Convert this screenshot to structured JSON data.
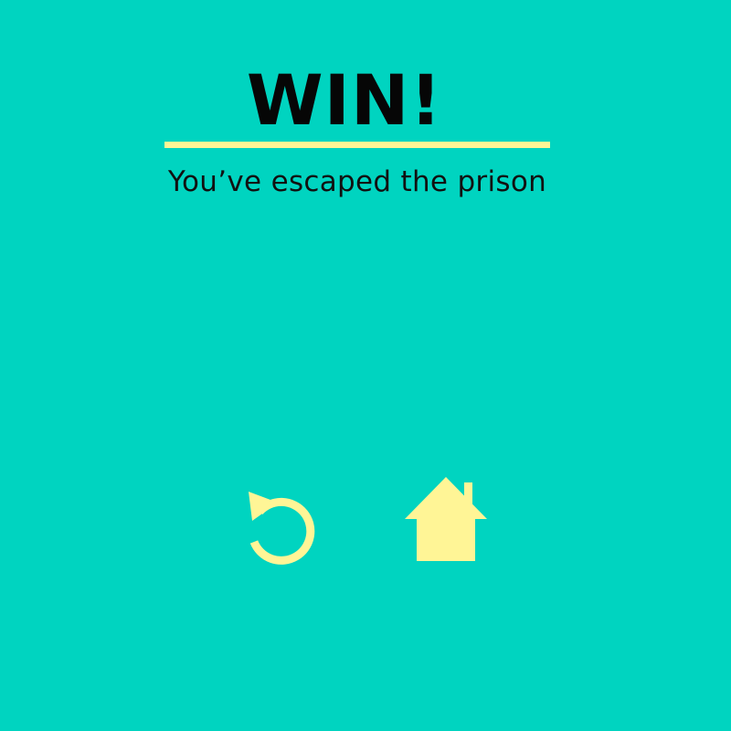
{
  "screen": {
    "title": "WIN!",
    "subtitle": "You’ve escaped the prison"
  },
  "actions": {
    "restart": {
      "icon": "restart-icon"
    },
    "home": {
      "icon": "home-icon"
    }
  },
  "colors": {
    "background": "#00d4c0",
    "accent": "#fff596",
    "text": "#060606"
  }
}
